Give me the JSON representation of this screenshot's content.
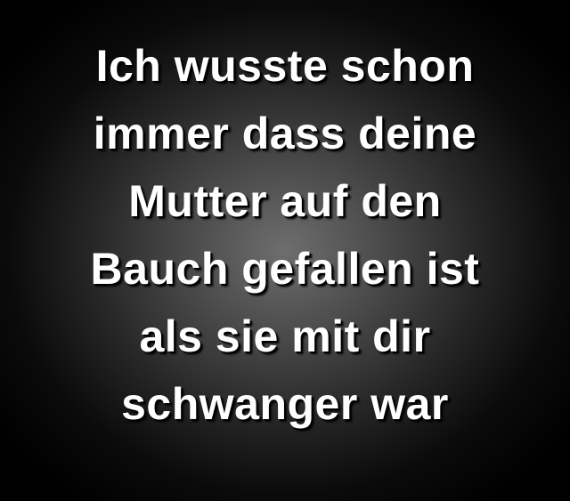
{
  "quote": {
    "lines": [
      "Ich wusste schon",
      "immer dass deine",
      "Mutter auf den",
      "Bauch gefallen ist",
      "als sie mit dir",
      "schwanger war"
    ]
  },
  "colors": {
    "background": "#000000",
    "glow_center": "#6e6e6e",
    "text": "#ffffff",
    "text_shadow": "#000000"
  }
}
